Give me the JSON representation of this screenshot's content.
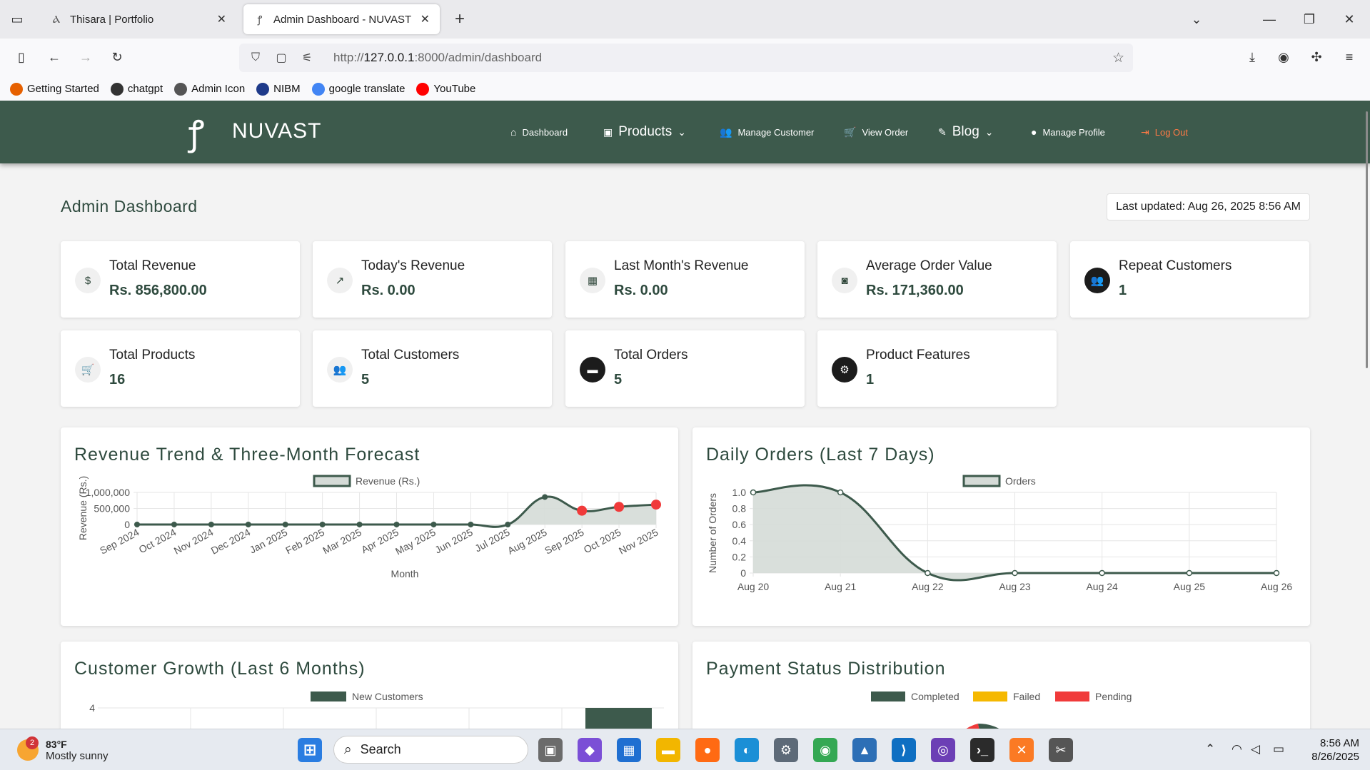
{
  "browser": {
    "tabs": [
      {
        "title": "Thisara | Portfolio",
        "icon": "portfolio-favicon"
      },
      {
        "title": "Admin Dashboard - NUVAST Fu",
        "icon": "nuvast-favicon"
      }
    ],
    "url_prefix": "http://",
    "url_host": "127.0.0.1",
    "url_rest": ":8000/admin/dashboard",
    "bookmarks": [
      {
        "label": "Getting Started",
        "color": "#e66000"
      },
      {
        "label": "chatgpt",
        "color": "#333333"
      },
      {
        "label": "Admin Icon",
        "color": "#555555"
      },
      {
        "label": "NIBM",
        "color": "#1e3a8a"
      },
      {
        "label": "google translate",
        "color": "#4285f4"
      },
      {
        "label": "YouTube",
        "color": "#ff0000"
      }
    ]
  },
  "site": {
    "brand": "NUVAST",
    "nav": [
      {
        "label": "Dashboard",
        "icon": "home-icon"
      },
      {
        "label": "Products",
        "icon": "box-icon"
      },
      {
        "label": "Manage Customer",
        "icon": "users-icon"
      },
      {
        "label": "View Order",
        "icon": "cart-icon"
      },
      {
        "label": "Blog",
        "icon": "blog-icon"
      },
      {
        "label": "Manage Profile",
        "icon": "user-icon"
      },
      {
        "label": "Log Out",
        "icon": "logout-icon"
      }
    ],
    "page_title": "Admin Dashboard",
    "last_updated": "Last updated: Aug 26, 2025 8:56 AM",
    "stats": [
      {
        "label": "Total Revenue",
        "value": "Rs. 856,800.00",
        "icon": "dollar-icon"
      },
      {
        "label": "Today's Revenue",
        "value": "Rs. 0.00",
        "icon": "chart-line-icon"
      },
      {
        "label": "Last Month's Revenue",
        "value": "Rs. 0.00",
        "icon": "calendar-icon"
      },
      {
        "label": "Average Order Value",
        "value": "Rs. 171,360.00",
        "icon": "money-icon"
      },
      {
        "label": "Repeat Customers",
        "value": "1",
        "icon": "user-group-icon"
      },
      {
        "label": "Total Products",
        "value": "16",
        "icon": "cart-icon"
      },
      {
        "label": "Total Customers",
        "value": "5",
        "icon": "users-icon"
      },
      {
        "label": "Total Orders",
        "value": "5",
        "icon": "credit-card-icon"
      },
      {
        "label": "Product Features",
        "value": "1",
        "icon": "gears-icon"
      }
    ],
    "panels": {
      "revenue_title": "Revenue Trend & Three-Month Forecast",
      "orders_title": "Daily Orders (Last 7 Days)",
      "customers_title": "Customer Growth (Last 6 Months)",
      "payment_title": "Payment Status Distribution"
    }
  },
  "chart_data": [
    {
      "type": "line",
      "title": "Revenue Trend & Three-Month Forecast",
      "xlabel": "Month",
      "ylabel": "Revenue (Rs.)",
      "categories": [
        "Sep 2024",
        "Oct 2024",
        "Nov 2024",
        "Dec 2024",
        "Jan 2025",
        "Feb 2025",
        "Mar 2025",
        "Apr 2025",
        "May 2025",
        "Jun 2025",
        "Jul 2025",
        "Aug 2025",
        "Sep 2025",
        "Oct 2025",
        "Nov 2025"
      ],
      "series": [
        {
          "name": "Revenue (Rs.)",
          "values": [
            0,
            0,
            0,
            0,
            0,
            0,
            0,
            0,
            0,
            0,
            0,
            856800,
            430000,
            550000,
            620000
          ]
        }
      ],
      "forecast_from_index": 12,
      "yticks": [
        "0",
        "500,000",
        "1,000,000"
      ],
      "ylim": [
        0,
        1000000
      ],
      "colors": {
        "line": "#3d5a4c",
        "fill": "#d5dbd7",
        "forecast": "#f03a3a"
      }
    },
    {
      "type": "line",
      "title": "Daily Orders (Last 7 Days)",
      "xlabel": "",
      "ylabel": "Number of Orders",
      "categories": [
        "Aug 20",
        "Aug 21",
        "Aug 22",
        "Aug 23",
        "Aug 24",
        "Aug 25",
        "Aug 26"
      ],
      "series": [
        {
          "name": "Orders",
          "values": [
            1,
            1,
            0,
            0,
            0,
            0,
            0
          ]
        }
      ],
      "yticks": [
        "0",
        "0.2",
        "0.4",
        "0.6",
        "0.8",
        "1.0"
      ],
      "ylim": [
        0,
        1
      ],
      "colors": {
        "line": "#3d5a4c",
        "fill": "#d5dbd7"
      }
    },
    {
      "type": "bar",
      "title": "Customer Growth (Last 6 Months)",
      "series": [
        {
          "name": "New Customers"
        }
      ],
      "yticks": [
        "4"
      ],
      "colors": {
        "bar": "#3d5a4c"
      }
    },
    {
      "type": "pie",
      "title": "Payment Status Distribution",
      "legend": [
        {
          "name": "Completed",
          "color": "#3d5a4c"
        },
        {
          "name": "Failed",
          "color": "#f5b800"
        },
        {
          "name": "Pending",
          "color": "#f03a3a"
        }
      ]
    }
  ],
  "taskbar": {
    "temperature": "83°F",
    "condition": "Mostly sunny",
    "badge": "2",
    "search_placeholder": "Search",
    "time": "8:56 AM",
    "date": "8/26/2025"
  }
}
